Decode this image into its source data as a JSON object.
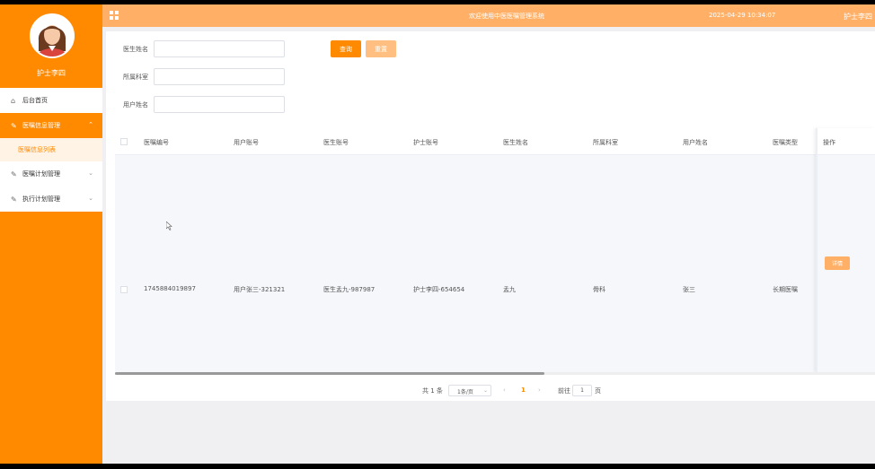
{
  "header": {
    "title": "欢迎使用中医医嘱管理系统",
    "datetime": "2025-04-29 10:34:07",
    "user": "护士李四"
  },
  "sidebar": {
    "username": "护士李四",
    "items": [
      {
        "label": "后台首页",
        "icon": "home-icon"
      },
      {
        "label": "医嘱信息管理",
        "icon": "edit-icon",
        "active": true,
        "sub": [
          "医嘱信息列表"
        ]
      },
      {
        "label": "医嘱计划管理",
        "icon": "edit-icon"
      },
      {
        "label": "执行计划管理",
        "icon": "edit-icon"
      }
    ]
  },
  "filters": {
    "doctor_name_label": "医生姓名",
    "department_label": "所属科室",
    "user_name_label": "用户姓名",
    "query_button": "查询",
    "reset_button": "重置"
  },
  "table": {
    "columns": [
      "医嘱编号",
      "用户账号",
      "医生账号",
      "护士账号",
      "医生姓名",
      "所属科室",
      "用户姓名",
      "医嘱类型",
      "操作"
    ],
    "rows": [
      {
        "order_no": "1745884019897",
        "user_account": "用户张三-321321",
        "doctor_account": "医生孟九-987987",
        "nurse_account": "护士李四-654654",
        "doctor_name": "孟九",
        "department": "骨科",
        "user_name": "张三",
        "order_type": "长期医嘱",
        "action": "详情"
      }
    ]
  },
  "pagination": {
    "total": "共 1 条",
    "page_size": "1条/页",
    "current_page": "1",
    "goto_label": "前往",
    "goto_value": "1",
    "page_unit": "页"
  },
  "colors": {
    "accent": "#ff8a00",
    "header": "#ffb066"
  }
}
